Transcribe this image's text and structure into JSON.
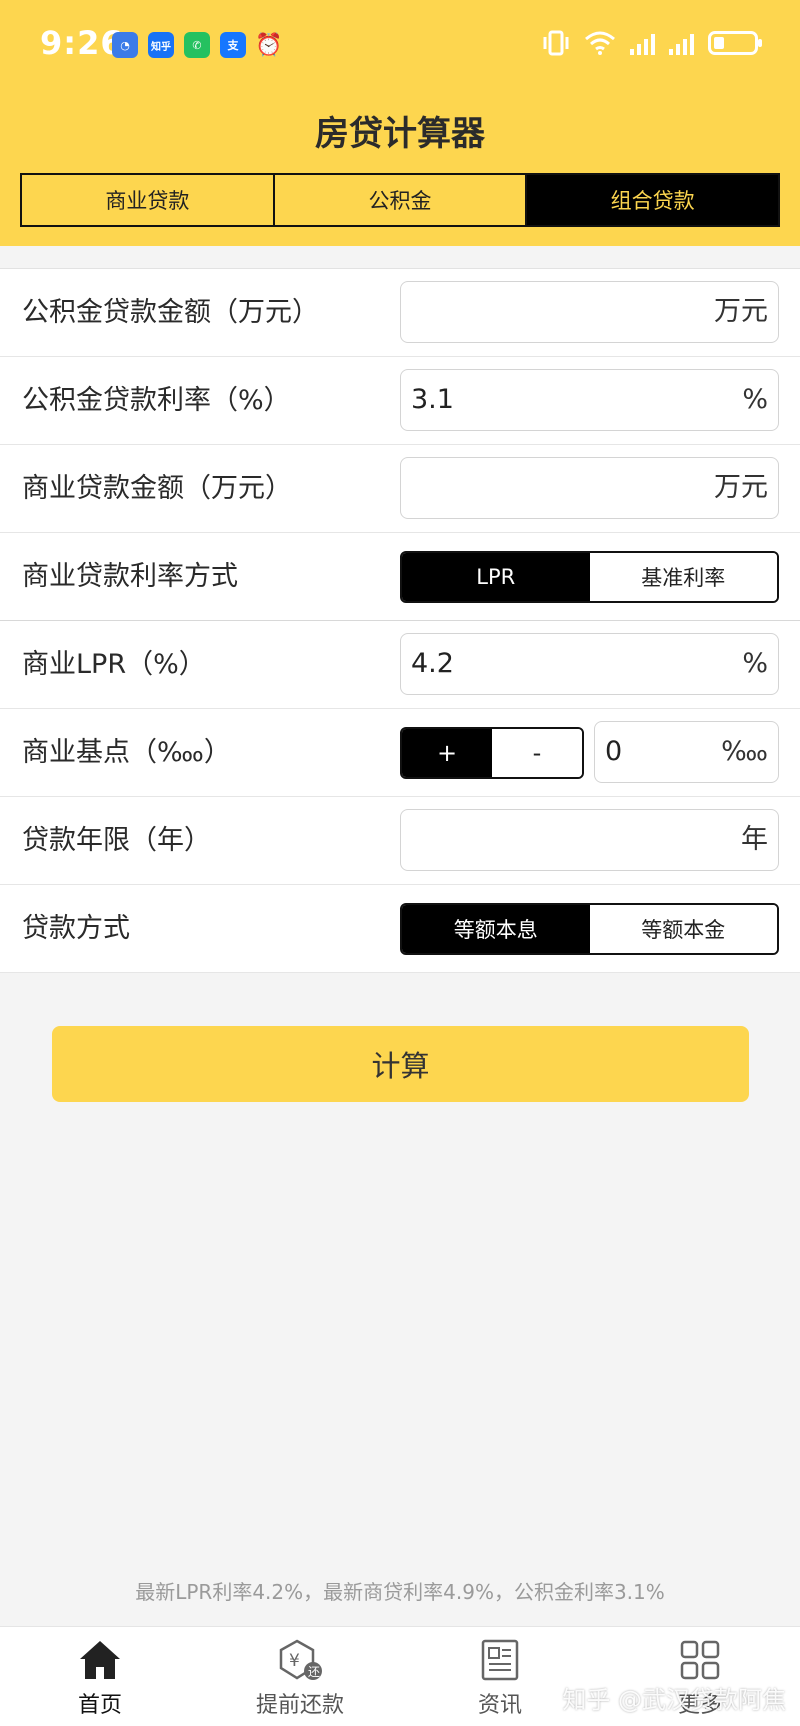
{
  "status": {
    "time": "9:26",
    "app_icons": [
      {
        "name": "clock-app-icon",
        "text": "◔",
        "color": "#3b7be8"
      },
      {
        "name": "zhihu-app-icon",
        "text": "知乎",
        "color": "#1772f6"
      },
      {
        "name": "wechat-app-icon",
        "text": "✆",
        "color": "#25c160"
      },
      {
        "name": "alipay-app-icon",
        "text": "支",
        "color": "#1677ff"
      },
      {
        "name": "alarm-app-icon",
        "text": "⏰",
        "color": "#fdd64f"
      }
    ]
  },
  "header": {
    "title": "房贷计算器",
    "tabs": [
      {
        "label": "商业贷款",
        "active": false
      },
      {
        "label": "公积金",
        "active": false
      },
      {
        "label": "组合贷款",
        "active": true
      }
    ]
  },
  "form": {
    "fund_amount": {
      "label": "公积金贷款金额（万元）",
      "value": "",
      "unit": "万元"
    },
    "fund_rate": {
      "label": "公积金贷款利率（%）",
      "value": "3.1",
      "unit": "%"
    },
    "commercial_amount": {
      "label": "商业贷款金额（万元）",
      "value": "",
      "unit": "万元"
    },
    "rate_mode": {
      "label": "商业贷款利率方式",
      "options": [
        "LPR",
        "基准利率"
      ],
      "selected": "LPR"
    },
    "lpr": {
      "label": "商业LPR（%）",
      "value": "4.2",
      "unit": "%"
    },
    "basis_points": {
      "label": "商业基点（‱）",
      "plus": "+",
      "minus": "-",
      "value": "0",
      "unit": "‱"
    },
    "years": {
      "label": "贷款年限（年）",
      "value": "",
      "unit": "年"
    },
    "method": {
      "label": "贷款方式",
      "options": [
        "等额本息",
        "等额本金"
      ],
      "selected": "等额本息"
    }
  },
  "calculate_label": "计算",
  "note": "最新LPR利率4.2%，最新商贷利率4.9%，公积金利率3.1%",
  "nav": [
    {
      "label": "首页",
      "icon": "home-icon",
      "active": true
    },
    {
      "label": "提前还款",
      "icon": "prepay-icon",
      "active": false
    },
    {
      "label": "资讯",
      "icon": "news-icon",
      "active": false
    },
    {
      "label": "更多",
      "icon": "grid-icon",
      "active": false
    }
  ],
  "watermark": "知乎 @武汉贷款阿焦",
  "colors": {
    "accent": "#fdd64f",
    "dark": "#000000"
  }
}
